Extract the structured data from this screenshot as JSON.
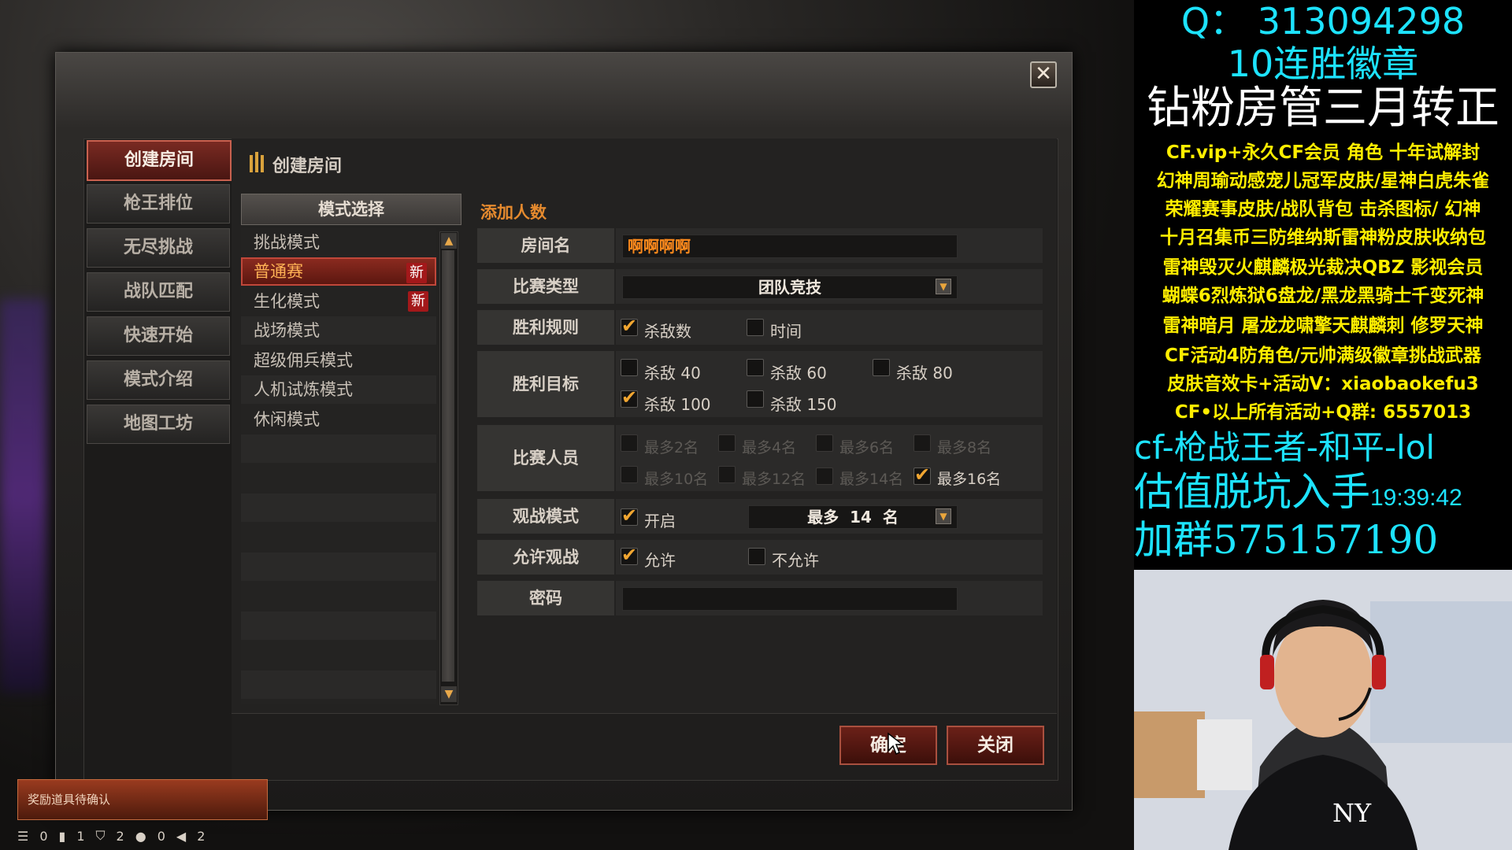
{
  "dialog": {
    "close_label": "✕",
    "sub_title": "创建房间"
  },
  "nav": {
    "items": [
      "创建房间",
      "枪王排位",
      "无尽挑战",
      "战队匹配",
      "快速开始",
      "模式介绍",
      "地图工坊"
    ],
    "active_index": 0
  },
  "modes": {
    "header": "模式选择",
    "items": [
      {
        "label": "挑战模式",
        "new": ""
      },
      {
        "label": "普通赛",
        "new": "新"
      },
      {
        "label": "生化模式",
        "new": "新"
      },
      {
        "label": "战场模式",
        "new": ""
      },
      {
        "label": "超级佣兵模式",
        "new": ""
      },
      {
        "label": "人机试炼模式",
        "new": ""
      },
      {
        "label": "休闲模式",
        "new": ""
      }
    ],
    "selected_index": 1,
    "scroll_up": "▲",
    "scroll_down": "▼"
  },
  "form": {
    "title": "添加人数",
    "room_name_label": "房间名",
    "room_name_value": "啊啊啊啊",
    "match_type_label": "比赛类型",
    "match_type_value": "团队竞技",
    "win_rule_label": "胜利规则",
    "win_rule_kills": "杀敌数",
    "win_rule_time": "时间",
    "win_target_label": "胜利目标",
    "win_targets": [
      "杀敌 40",
      "杀敌 60",
      "杀敌 80",
      "杀敌 100",
      "杀敌 150"
    ],
    "players_label": "比赛人员",
    "players_options": [
      "最多2名",
      "最多4名",
      "最多6名",
      "最多8名",
      "最多10名",
      "最多12名",
      "最多14名",
      "最多16名"
    ],
    "spectate_mode_label": "观战模式",
    "spectate_on": "开启",
    "spectate_max": "最多  14  名",
    "allow_spectate_label": "允许观战",
    "allow": "允许",
    "disallow": "不允许",
    "password_label": "密码",
    "dropdown_arrow": "▼"
  },
  "buttons": {
    "confirm": "确定",
    "close": "关闭"
  },
  "notification": {
    "text": "奖励道具待确认"
  },
  "statusbar": {
    "menu_icon": "☰",
    "values": [
      "0",
      "1",
      "2",
      "0",
      "2"
    ]
  },
  "stream_overlay": {
    "lines": [
      "Q： 313094298",
      "10连胜徽章",
      "钻粉房管三月转正",
      "CF.vip+永久CF会员 角色 十年试解封",
      "幻神周瑜动感宠儿冠军皮肤/星神白虎朱雀",
      "荣耀赛事皮肤/战队背包 击杀图标/ 幻神",
      "十月召集币三防维纳斯雷神粉皮肤收纳包",
      "雷神毁灭火麒麟极光裁决QBZ 影视会员",
      "蝴蝶6烈炼狱6盘龙/黑龙黑骑士千变死神",
      "雷神暗月 屠龙龙啸擎天麒麟刺 修罗天神",
      "CF活动4防角色/元帅满级徽章挑战武器",
      "皮肤音效卡+活动V：xiaobaokefu3",
      "CF•以上所有活动+Q群: 6557013",
      "cf-枪战王者-和平-lol",
      "估值脱坑入手",
      "加群575157190"
    ],
    "clock": "19:39:42",
    "colors": {
      "cyan": "#1de3ff",
      "white": "#ffffff",
      "yellow": "#ffee00"
    }
  }
}
